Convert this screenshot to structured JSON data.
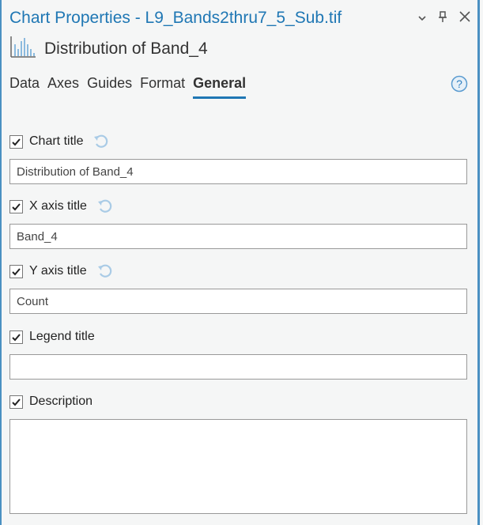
{
  "window": {
    "title": "Chart Properties - L9_Bands2thru7_5_Sub.tif",
    "controls": [
      "chevron-down-icon",
      "pin-icon",
      "close-icon"
    ]
  },
  "chart": {
    "icon": "histogram-icon",
    "name": "Distribution of Band_4"
  },
  "tabs": [
    {
      "label": "Data",
      "active": false
    },
    {
      "label": "Axes",
      "active": false
    },
    {
      "label": "Guides",
      "active": false
    },
    {
      "label": "Format",
      "active": false
    },
    {
      "label": "General",
      "active": true
    }
  ],
  "help_icon": "help-icon",
  "sections": {
    "chart_title": {
      "label": "Chart title",
      "checked": true,
      "value": "Distribution of Band_4",
      "has_reset": true
    },
    "x_axis_title": {
      "label": "X axis title",
      "checked": true,
      "value": "Band_4",
      "has_reset": true
    },
    "y_axis_title": {
      "label": "Y axis title",
      "checked": true,
      "value": "Count",
      "has_reset": true
    },
    "legend_title": {
      "label": "Legend title",
      "checked": true,
      "value": "",
      "has_reset": false
    },
    "description": {
      "label": "Description",
      "checked": true,
      "value": "",
      "has_reset": false
    }
  },
  "colors": {
    "accent": "#1f77b4",
    "border": "#4a90c2",
    "reset_icon": "#a9cbe6"
  }
}
